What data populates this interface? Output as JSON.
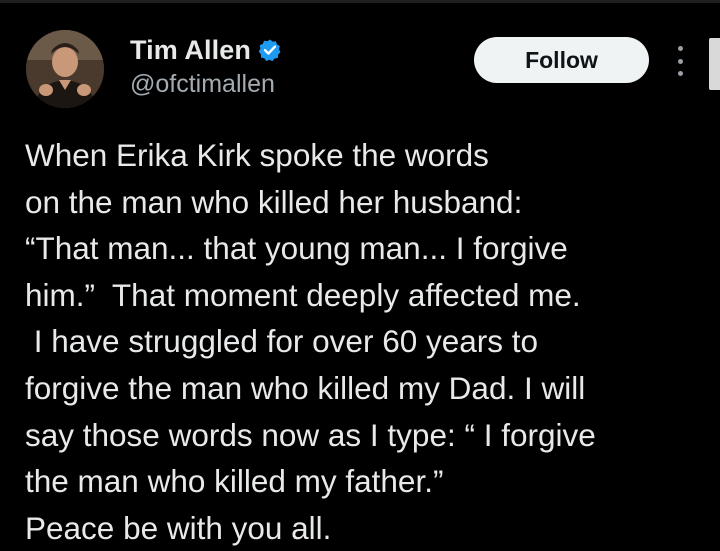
{
  "post": {
    "author": {
      "display_name": "Tim Allen",
      "handle": "@ofctimallen",
      "verified": true,
      "avatar_icon": "profile-photo-man-dark-jacket"
    },
    "follow_label": "Follow",
    "more_icon": "more-vertical-icon",
    "text_lines": [
      "When Erika Kirk spoke the words",
      "on the man who killed her husband:",
      "“That man... that young man... I forgive",
      "him.”  That moment deeply affected me.",
      " I have struggled for over 60 years to",
      "forgive the man who killed my Dad. I will",
      "say those words now as I type: “ I forgive",
      "the man who killed my father.”",
      "Peace be with you all."
    ]
  },
  "colors": {
    "background": "#000000",
    "text_primary": "#e7e9ea",
    "text_secondary": "#a4abb1",
    "verified_badge": "#1d9bf0",
    "follow_button_bg": "#eff3f4",
    "follow_button_text": "#0f1419"
  }
}
